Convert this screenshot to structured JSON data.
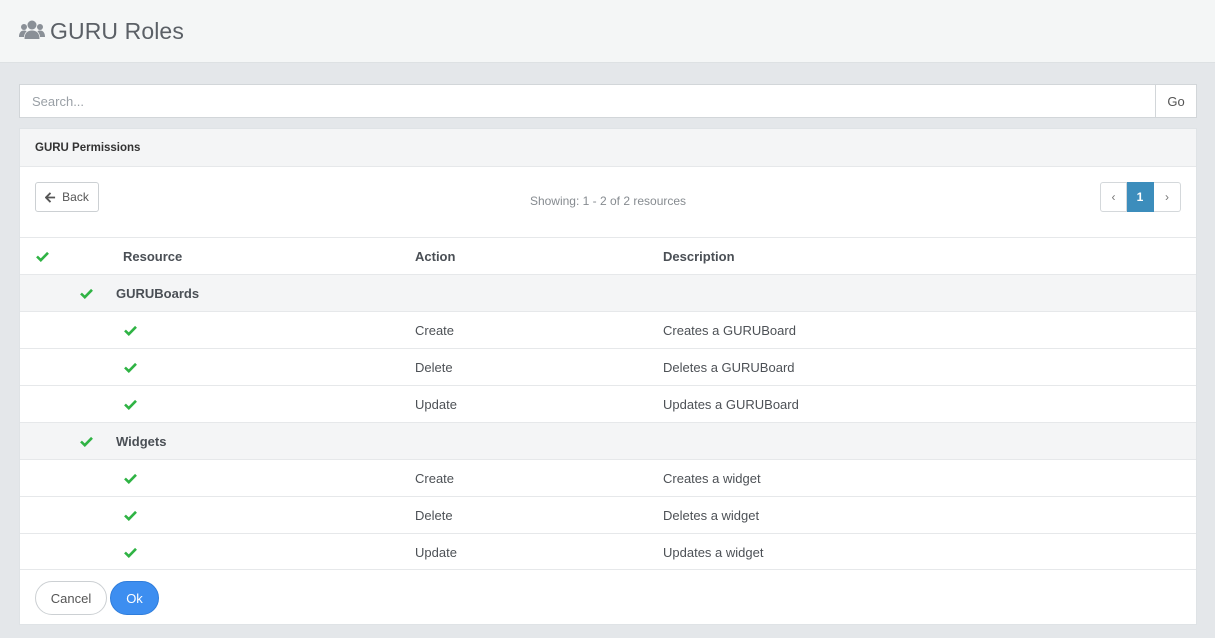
{
  "header": {
    "title": "GURU Roles",
    "icon": "users-icon"
  },
  "search": {
    "placeholder": "Search...",
    "go_label": "Go"
  },
  "panel": {
    "title": "GURU Permissions",
    "back_label": "Back",
    "showing_text": "Showing: 1 - 2 of 2 resources",
    "pagination": {
      "prev": "‹",
      "current": "1",
      "next": "›"
    }
  },
  "table": {
    "headers": {
      "resource": "Resource",
      "action": "Action",
      "description": "Description"
    },
    "groups": [
      {
        "name": "GURUBoards",
        "rows": [
          {
            "action": "Create",
            "description": "Creates a GURUBoard"
          },
          {
            "action": "Delete",
            "description": "Deletes a GURUBoard"
          },
          {
            "action": "Update",
            "description": "Updates a GURUBoard"
          }
        ]
      },
      {
        "name": "Widgets",
        "rows": [
          {
            "action": "Create",
            "description": "Creates a widget"
          },
          {
            "action": "Delete",
            "description": "Deletes a widget"
          },
          {
            "action": "Update",
            "description": "Updates a widget"
          }
        ]
      }
    ]
  },
  "footer": {
    "cancel_label": "Cancel",
    "ok_label": "Ok"
  },
  "colors": {
    "check": "#2fb344",
    "primary": "#3d8ef0",
    "page_active": "#3c8dbc"
  }
}
